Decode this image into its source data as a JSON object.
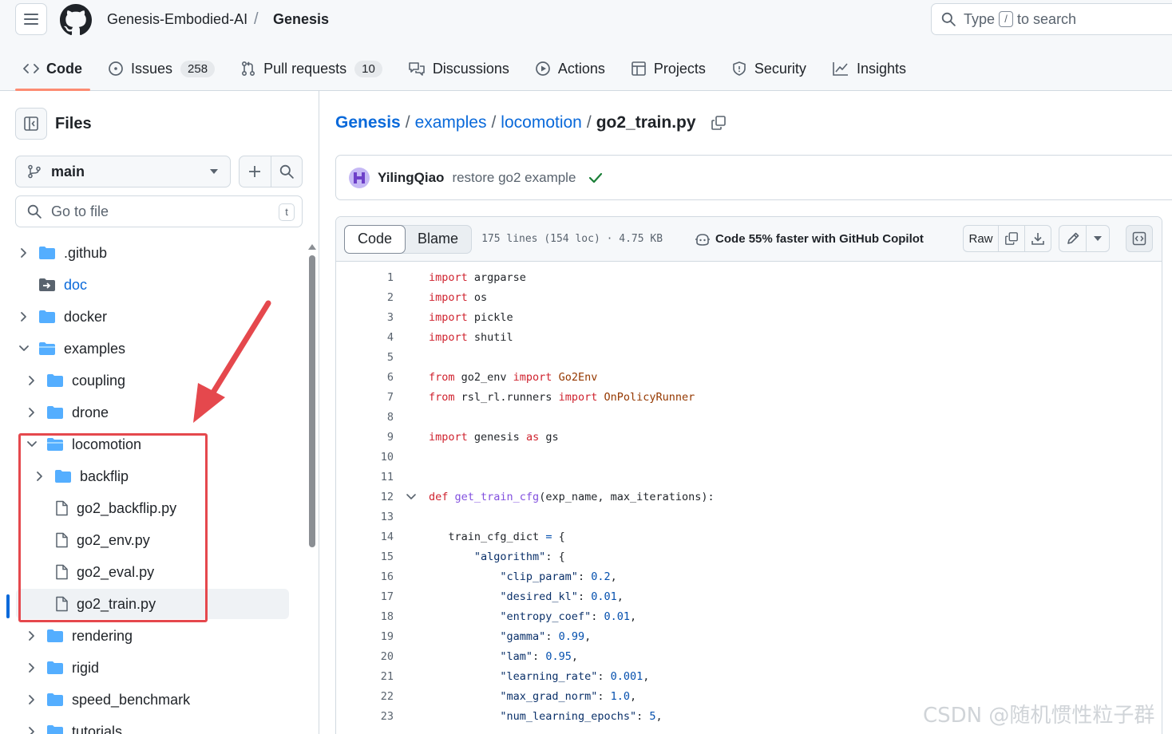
{
  "header": {
    "owner": "Genesis-Embodied-AI",
    "separator": "/",
    "repo": "Genesis",
    "search_prefix": "Type",
    "search_key": "/",
    "search_suffix": "to search"
  },
  "tabs": [
    {
      "label": "Code",
      "icon": "code-icon",
      "active": true
    },
    {
      "label": "Issues",
      "icon": "issue-icon",
      "count": "258"
    },
    {
      "label": "Pull requests",
      "icon": "pull-request-icon",
      "count": "10"
    },
    {
      "label": "Discussions",
      "icon": "discussions-icon"
    },
    {
      "label": "Actions",
      "icon": "play-icon"
    },
    {
      "label": "Projects",
      "icon": "table-icon"
    },
    {
      "label": "Security",
      "icon": "shield-icon"
    },
    {
      "label": "Insights",
      "icon": "graph-icon"
    }
  ],
  "sidebar": {
    "title": "Files",
    "branch": "main",
    "goto_placeholder": "Go to file",
    "goto_key": "t",
    "tree": [
      {
        "label": ".github",
        "type": "folder",
        "depth": 0,
        "expanded": false
      },
      {
        "label": "doc",
        "type": "submodule",
        "depth": 0,
        "link": true
      },
      {
        "label": "docker",
        "type": "folder",
        "depth": 0,
        "expanded": false
      },
      {
        "label": "examples",
        "type": "folder-open",
        "depth": 0,
        "expanded": true
      },
      {
        "label": "coupling",
        "type": "folder",
        "depth": 1,
        "expanded": false
      },
      {
        "label": "drone",
        "type": "folder",
        "depth": 1,
        "expanded": false
      },
      {
        "label": "locomotion",
        "type": "folder-open",
        "depth": 1,
        "expanded": true
      },
      {
        "label": "backflip",
        "type": "folder",
        "depth": 2,
        "expanded": false
      },
      {
        "label": "go2_backflip.py",
        "type": "file",
        "depth": 2
      },
      {
        "label": "go2_env.py",
        "type": "file",
        "depth": 2
      },
      {
        "label": "go2_eval.py",
        "type": "file",
        "depth": 2
      },
      {
        "label": "go2_train.py",
        "type": "file",
        "depth": 2,
        "selected": true
      },
      {
        "label": "rendering",
        "type": "folder",
        "depth": 1,
        "expanded": false
      },
      {
        "label": "rigid",
        "type": "folder",
        "depth": 1,
        "expanded": false
      },
      {
        "label": "speed_benchmark",
        "type": "folder",
        "depth": 1,
        "expanded": false
      },
      {
        "label": "tutorials",
        "type": "folder",
        "depth": 1,
        "expanded": false
      }
    ]
  },
  "breadcrumb": {
    "parts": [
      "Genesis",
      "examples",
      "locomotion"
    ],
    "divider": "/",
    "current": "go2_train.py"
  },
  "commit": {
    "author": "YilingQiao",
    "message": "restore go2 example",
    "status": "success"
  },
  "file": {
    "tab_code": "Code",
    "tab_blame": "Blame",
    "meta": "175 lines (154 loc) · 4.75 KB",
    "copilot": "Code 55% faster with GitHub Copilot",
    "raw_label": "Raw"
  },
  "code_lines": [
    {
      "n": "1",
      "tokens": [
        [
          "kw",
          "import"
        ],
        [
          "",
          "  argparse"
        ]
      ]
    },
    {
      "n": "2",
      "tokens": [
        [
          "kw",
          "import"
        ],
        [
          "",
          " os"
        ]
      ]
    },
    {
      "n": "3",
      "tokens": [
        [
          "kw",
          "import"
        ],
        [
          "",
          " pickle"
        ]
      ]
    },
    {
      "n": "4",
      "tokens": [
        [
          "kw",
          "import"
        ],
        [
          "",
          " shutil"
        ]
      ]
    },
    {
      "n": "5",
      "tokens": []
    },
    {
      "n": "6",
      "tokens": [
        [
          "kw",
          "from"
        ],
        [
          "",
          " go2_env "
        ],
        [
          "kw",
          "import"
        ],
        [
          "cls",
          " Go2Env"
        ]
      ]
    },
    {
      "n": "7",
      "tokens": [
        [
          "kw",
          "from"
        ],
        [
          "",
          " rsl_rl.runners "
        ],
        [
          "kw",
          "import"
        ],
        [
          "cls",
          " OnPolicyRunner"
        ]
      ]
    },
    {
      "n": "8",
      "tokens": []
    },
    {
      "n": "9",
      "tokens": [
        [
          "kw",
          "import"
        ],
        [
          "",
          " genesis "
        ],
        [
          "kw",
          "as"
        ],
        [
          "",
          " gs"
        ]
      ]
    },
    {
      "n": "10",
      "tokens": []
    },
    {
      "n": "11",
      "tokens": []
    },
    {
      "n": "12",
      "fold": true,
      "tokens": [
        [
          "kw",
          "def"
        ],
        [
          "fn",
          " get_train_cfg"
        ],
        [
          "",
          "(exp_name, max_iterations):"
        ]
      ]
    },
    {
      "n": "13",
      "tokens": []
    },
    {
      "n": "14",
      "tokens": [
        [
          "",
          "    train_cfg_dict "
        ],
        [
          "op",
          "="
        ],
        [
          "",
          " {"
        ]
      ]
    },
    {
      "n": "15",
      "tokens": [
        [
          "",
          "        "
        ],
        [
          "str",
          "\"algorithm\""
        ],
        [
          "",
          ": {"
        ]
      ]
    },
    {
      "n": "16",
      "tokens": [
        [
          "",
          "            "
        ],
        [
          "str",
          "\"clip_param\""
        ],
        [
          "",
          ": "
        ],
        [
          "num",
          "0.2"
        ],
        [
          "",
          ","
        ]
      ]
    },
    {
      "n": "17",
      "tokens": [
        [
          "",
          "            "
        ],
        [
          "str",
          "\"desired_kl\""
        ],
        [
          "",
          ": "
        ],
        [
          "num",
          "0.01"
        ],
        [
          "",
          ","
        ]
      ]
    },
    {
      "n": "18",
      "tokens": [
        [
          "",
          "            "
        ],
        [
          "str",
          "\"entropy_coef\""
        ],
        [
          "",
          ": "
        ],
        [
          "num",
          "0.01"
        ],
        [
          "",
          ","
        ]
      ]
    },
    {
      "n": "19",
      "tokens": [
        [
          "",
          "            "
        ],
        [
          "str",
          "\"gamma\""
        ],
        [
          "",
          ": "
        ],
        [
          "num",
          "0.99"
        ],
        [
          "",
          ","
        ]
      ]
    },
    {
      "n": "20",
      "tokens": [
        [
          "",
          "            "
        ],
        [
          "str",
          "\"lam\""
        ],
        [
          "",
          ": "
        ],
        [
          "num",
          "0.95"
        ],
        [
          "",
          ","
        ]
      ]
    },
    {
      "n": "21",
      "tokens": [
        [
          "",
          "            "
        ],
        [
          "str",
          "\"learning_rate\""
        ],
        [
          "",
          ": "
        ],
        [
          "num",
          "0.001"
        ],
        [
          "",
          ","
        ]
      ]
    },
    {
      "n": "22",
      "tokens": [
        [
          "",
          "            "
        ],
        [
          "str",
          "\"max_grad_norm\""
        ],
        [
          "",
          ": "
        ],
        [
          "num",
          "1.0"
        ],
        [
          "",
          ","
        ]
      ]
    },
    {
      "n": "23",
      "tokens": [
        [
          "",
          "            "
        ],
        [
          "str",
          "\"num_learning_epochs\""
        ],
        [
          "",
          ": "
        ],
        [
          "num",
          "5"
        ],
        [
          "",
          ","
        ]
      ]
    }
  ],
  "watermark": "CSDN @随机惯性粒子群",
  "colors": {
    "accent": "#0969da",
    "tab_underline": "#fd8c73",
    "annotation_red": "#e5484d",
    "folder": "#54aeff",
    "success": "#1a7f37"
  }
}
